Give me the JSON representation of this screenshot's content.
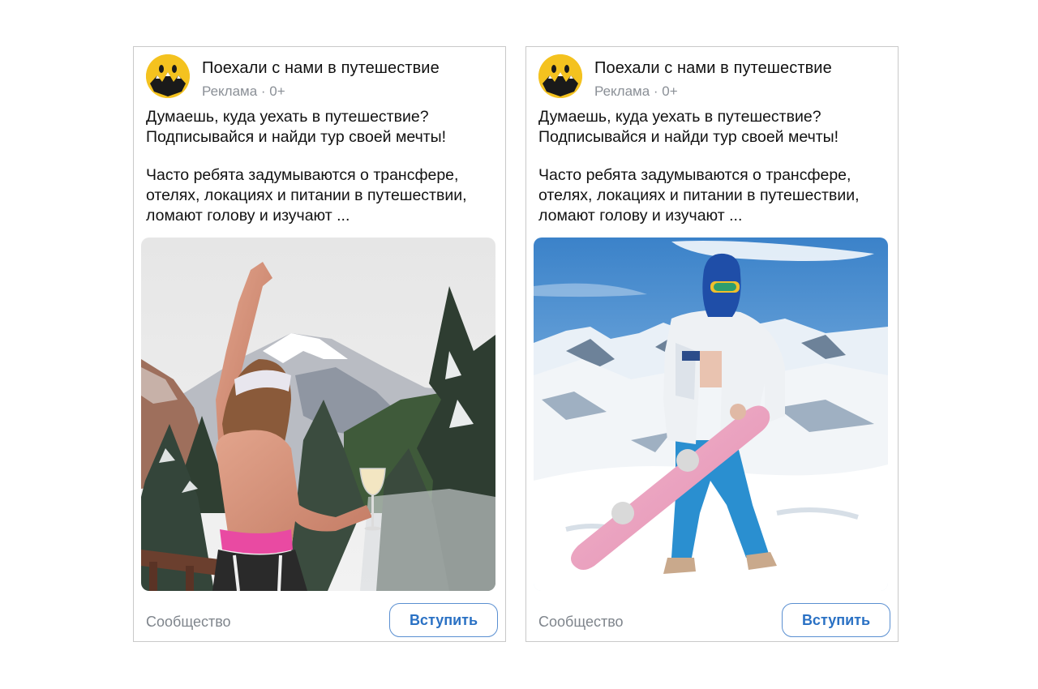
{
  "ads": [
    {
      "community_name": "Поехали с нами в путешествие",
      "meta": "Реклама · 0+",
      "text_line1": "Думаешь, куда уехать в путешествие? Подписывайся и найди тур своей мечты!",
      "text_line2": "Часто ребята задумываются о трансфере, отелях, локациях и питании в путешествии, ломают голову и изучают ...",
      "footer_label": "Сообщество",
      "join_label": "Вступить",
      "image": "woman-with-wine-glass-mountain-view-photo"
    },
    {
      "community_name": "Поехали с нами в путешествие",
      "meta": "Реклама · 0+",
      "text_line1": "Думаешь, куда уехать в путешествие? Подписывайся и найди тур своей мечты!",
      "text_line2": "Часто ребята задумываются о трансфере, отелях, локациях и питании в путешествии, ломают голову и изучают ...",
      "footer_label": "Сообщество",
      "join_label": "Вступить",
      "image": "snowboarder-in-blue-balaclava-photo"
    }
  ],
  "colors": {
    "avatar_yellow": "#f4c21f",
    "accent_blue": "#2a71c4",
    "muted_gray": "#8a8f96",
    "border": "#c9c9c9"
  }
}
